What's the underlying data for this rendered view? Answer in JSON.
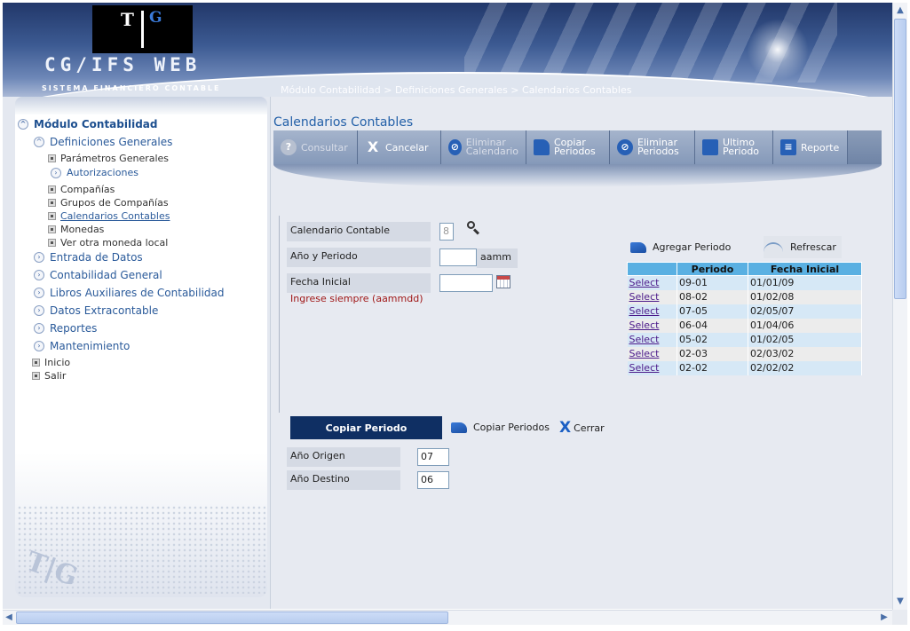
{
  "header": {
    "logo_t": "T",
    "logo_g": "G",
    "app_title": "CG/IFS WEB",
    "app_subtitle": "SISTEMA FINANCIERO CONTABLE",
    "breadcrumb": "Módulo Contabilidad > Definiciones Generales > Calendarios Contables"
  },
  "sidebar": {
    "module": "Módulo Contabilidad",
    "section": "Definiciones Generales",
    "sub_items": [
      {
        "label": "Parámetros Generales"
      },
      {
        "label": "Autorizaciones"
      },
      {
        "label": "Compañías"
      },
      {
        "label": "Grupos de Compañías"
      },
      {
        "label": "Calendarios Contables"
      },
      {
        "label": "Monedas"
      },
      {
        "label": "Ver otra moneda local"
      }
    ],
    "sections": [
      {
        "label": "Entrada de Datos"
      },
      {
        "label": "Contabilidad General"
      },
      {
        "label": "Libros Auxiliares de Contabilidad"
      },
      {
        "label": "Datos Extracontable"
      },
      {
        "label": "Reportes"
      },
      {
        "label": "Mantenimiento"
      }
    ],
    "bottom": [
      {
        "label": "Inicio"
      },
      {
        "label": "Salir"
      }
    ],
    "watermark": "T|G"
  },
  "main": {
    "title": "Calendarios Contables",
    "toolbar": {
      "consultar": "Consultar",
      "cancelar": "Cancelar",
      "eliminar_calendario_1": "Eliminar",
      "eliminar_calendario_2": "Calendario",
      "copiar_periodos_1": "Copiar",
      "copiar_periodos_2": "Periodos",
      "eliminar_periodos_1": "Eliminar",
      "eliminar_periodos_2": "Periodos",
      "ultimo_periodo_1": "Ultimo",
      "ultimo_periodo_2": "Periodo",
      "reporte": "Reporte"
    },
    "form": {
      "calendario_label": "Calendario Contable",
      "calendario_value": "8",
      "anio_periodo_label": "Año y Periodo",
      "anio_periodo_value": "",
      "anio_periodo_unit": "aamm",
      "fecha_inicial_label": "Fecha Inicial",
      "fecha_inicial_value": "",
      "hint": "Ingrese siempre (aammdd)"
    },
    "actions": {
      "agregar": "Agregar Periodo",
      "refrescar": "Refrescar"
    },
    "table": {
      "headers": [
        "",
        "Periodo",
        "Fecha Inicial"
      ],
      "select_label": "Select",
      "rows": [
        {
          "periodo": "09-01",
          "fecha": "01/01/09"
        },
        {
          "periodo": "08-02",
          "fecha": "01/02/08"
        },
        {
          "periodo": "07-05",
          "fecha": "02/05/07"
        },
        {
          "periodo": "06-04",
          "fecha": "01/04/06"
        },
        {
          "periodo": "05-02",
          "fecha": "01/02/05"
        },
        {
          "periodo": "02-03",
          "fecha": "02/03/02"
        },
        {
          "periodo": "02-02",
          "fecha": "02/02/02"
        }
      ]
    },
    "copy": {
      "button": "Copiar Periodo",
      "copiar_periodos": "Copiar Periodos",
      "cerrar": "Cerrar",
      "origen_label": "Año Origen",
      "origen_value": "07",
      "destino_label": "Año Destino",
      "destino_value": "06"
    }
  },
  "colors": {
    "accent": "#2360a8",
    "table_header": "#5ab0e2",
    "button_dark": "#0f2f63",
    "hint": "#a01818"
  },
  "icons": [
    "search-icon",
    "calendar-icon",
    "pen-icon",
    "refresh-icon",
    "close-icon",
    "help-icon",
    "report-icon"
  ]
}
